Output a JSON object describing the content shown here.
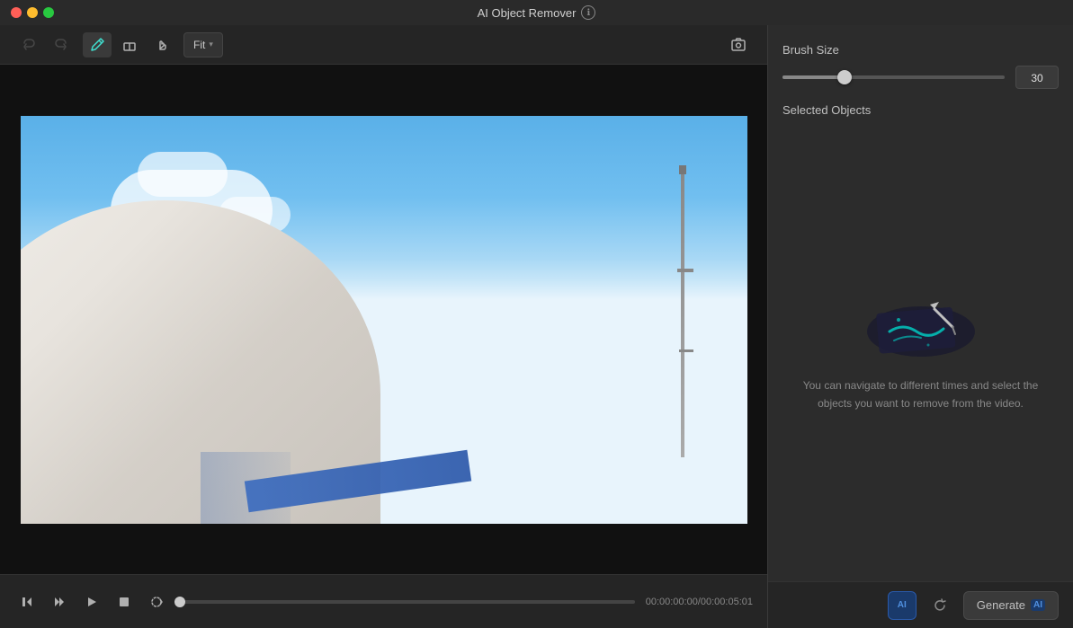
{
  "titleBar": {
    "title": "AI Object Remover",
    "infoIcon": "ℹ"
  },
  "toolbar": {
    "undoLabel": "↩",
    "redoLabel": "↪",
    "brushLabel": "✏",
    "eraseLabel": "⌫",
    "moveLabel": "✋",
    "fitLabel": "Fit",
    "fitChevron": "▾",
    "screenshotLabel": "🖼"
  },
  "timeline": {
    "stepBackLabel": "⏮",
    "playBackLabel": "⏭",
    "playLabel": "▶",
    "stopLabel": "■",
    "loopLabel": "⟳",
    "timeCode": "00:00:00:00/00:00:05:01"
  },
  "rightPanel": {
    "brushSizeLabel": "Brush Size",
    "brushValue": "30",
    "selectedObjectsLabel": "Selected Objects",
    "emptyHintText": "You can navigate to different times and select the objects you want to remove from the video."
  },
  "bottomBar": {
    "aiBadgeLabel": "AI",
    "generateLabel": "Generate",
    "generateAiLabel": "AI"
  }
}
